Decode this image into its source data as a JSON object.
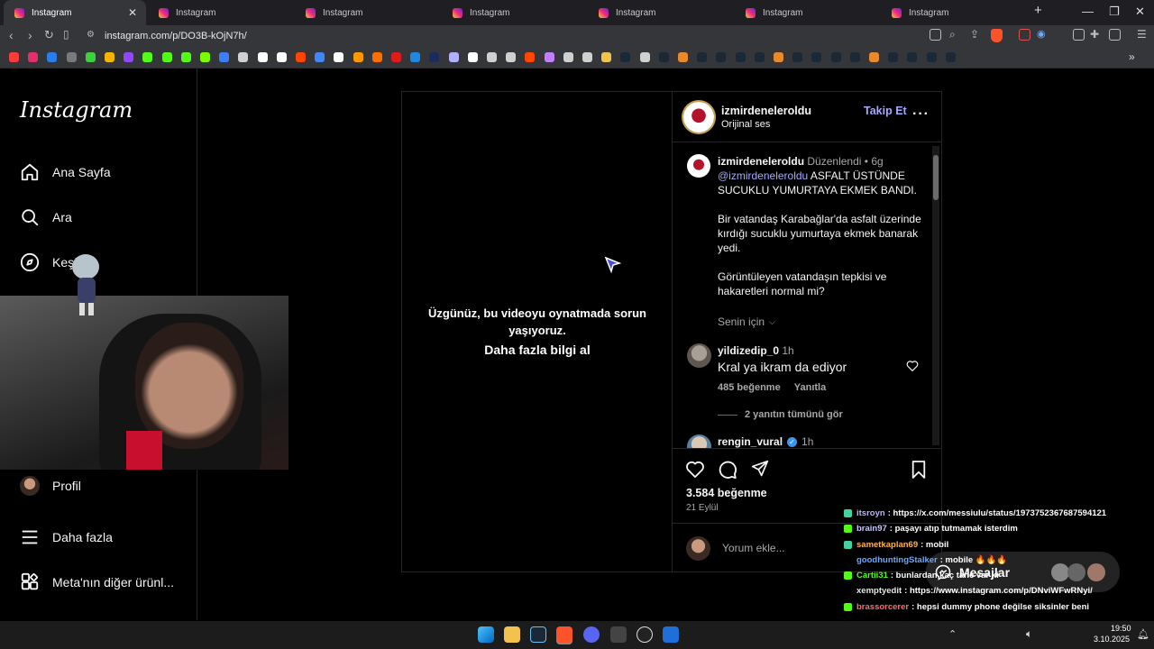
{
  "browser": {
    "tabs": [
      {
        "label": "Instagram",
        "active": true
      },
      {
        "label": "Instagram"
      },
      {
        "label": "Instagram"
      },
      {
        "label": "Instagram"
      },
      {
        "label": "Instagram"
      },
      {
        "label": "Instagram"
      },
      {
        "label": "Instagram"
      }
    ],
    "url": "instagram.com/p/DO3B-kOjN7h/"
  },
  "sidebar": {
    "logo": "Instagram",
    "items": [
      {
        "label": "Ana Sayfa",
        "icon": "home-icon"
      },
      {
        "label": "Ara",
        "icon": "search-icon"
      },
      {
        "label": "Keşfet",
        "icon": "compass-icon"
      },
      {
        "label": "Profil",
        "icon": "avatar"
      },
      {
        "label": "Daha fazla",
        "icon": "menu-icon"
      },
      {
        "label": "Meta'nın diğer ürünl...",
        "icon": "apps-icon"
      }
    ],
    "visible_kesfet_label": "Keşf"
  },
  "video": {
    "error_message": "Üzgünüz, bu videoyu oynatmada sorun yaşıyoruz.",
    "learn_more": "Daha fazla bilgi al"
  },
  "post": {
    "username": "izmirdeneleroldu",
    "audio": "Orijinal ses",
    "follow_label": "Takip Et",
    "caption": {
      "username": "izmirdeneleroldu",
      "edited": "Düzenlendi",
      "time": "6g",
      "mention": "@izmirdeneleroldu",
      "line1": "ASFALT ÜSTÜNDE SUCUKLU YUMURTAYA EKMEK BANDI.",
      "para2": "Bir vatandaş Karabağlar'da asfalt üzerinde kırdığı sucuklu yumurtaya ekmek banarak yedi.",
      "para3": "Görüntüleyen vatandaşın tepkisi ve hakaretleri normal mi?",
      "translate": "Senin için"
    },
    "comments": [
      {
        "username": "yildizedip_0",
        "time": "1h",
        "text": "Kral ya ikram da ediyor",
        "likes": "485 beğenme",
        "reply": "Yanıtla",
        "view_replies": "2 yanıtın tümünü gör"
      },
      {
        "username": "rengin_vural",
        "time": "1h"
      }
    ],
    "likes": "3.584 beğenme",
    "date": "21 Eylül",
    "add_comment_placeholder": "Yorum ekle..."
  },
  "chat": {
    "messages": [
      {
        "user": "itsroyn",
        "text": ": https://x.com/messiulu/status/1973752367687594121",
        "color": "#b8b8ff",
        "platform": "#45d1a0"
      },
      {
        "user": "brain97",
        "text": ": paşayı atıp tutmamak isterdim",
        "color": "#c8c8ff",
        "platform": "#53fc18"
      },
      {
        "user": "sametkaplan69",
        "text": ": mobil",
        "color": "#ffb14a",
        "platform": "#45d1a0"
      },
      {
        "user": "goodhuntingStalker",
        "text": ": mobile 🔥🔥🔥",
        "color": "#6aa8ff",
        "platform": ""
      },
      {
        "user": "Cartii31",
        "text": ": bunlardan kaç tane var ki",
        "color": "#53fc18",
        "platform": "#53fc18"
      },
      {
        "user": "xemptyedit",
        "text": ": https://www.instagram.com/p/DNviWFwRNyi/",
        "color": "#e6e6e6",
        "platform": ""
      },
      {
        "user": "brassorcerer",
        "text": ": hepsi dummy phone değilse siksinler beni",
        "color": "#ff6b6b",
        "platform": "#53fc18"
      }
    ]
  },
  "messages_button": "Mesajlar",
  "taskbar": {
    "time": "19:50",
    "date": "3.10.2025"
  },
  "colors": {
    "link": "#a5a8ff",
    "bg": "#000000",
    "border": "#262626",
    "brave": "#fb542b"
  }
}
